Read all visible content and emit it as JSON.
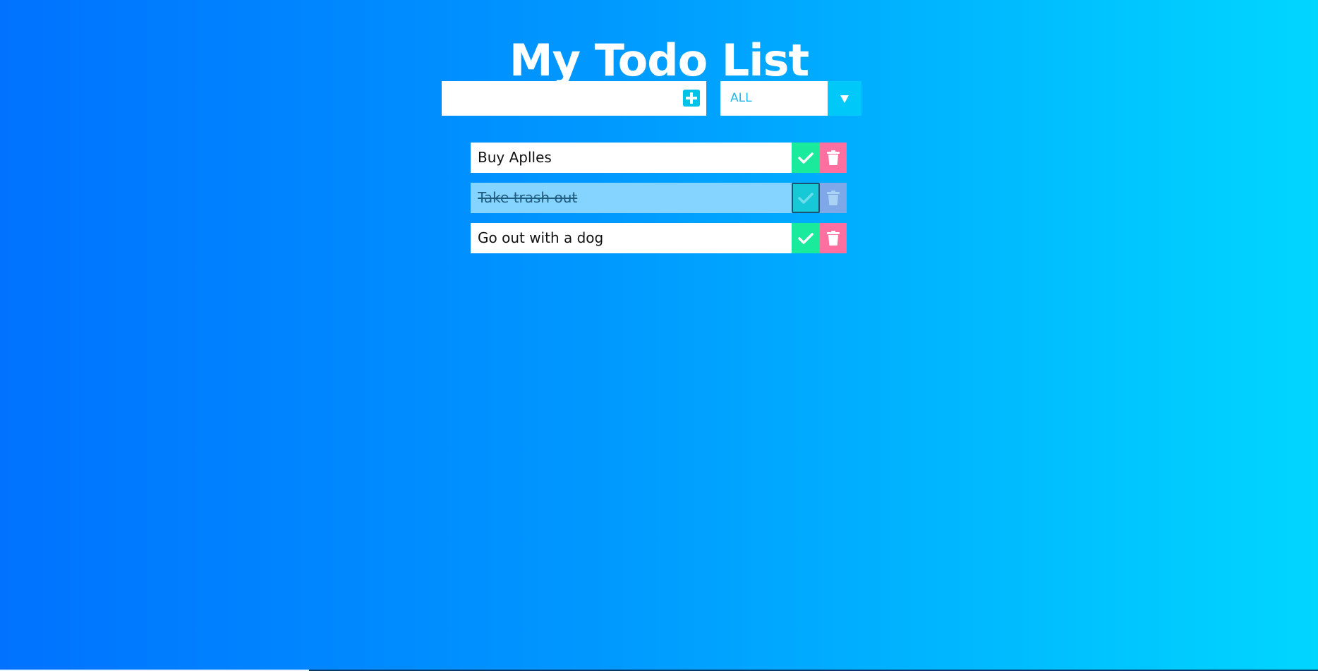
{
  "header": {
    "title": "My Todo List"
  },
  "add_form": {
    "input_value": "",
    "input_placeholder": "",
    "add_icon": "plus-square-icon"
  },
  "filter": {
    "selected": "ALL",
    "arrow_icon": "triangle-down-icon"
  },
  "todos": [
    {
      "text": "Buy Aplles",
      "completed": false
    },
    {
      "text": "Take trash out",
      "completed": true
    },
    {
      "text": "Go out with a dog",
      "completed": false
    }
  ],
  "icons": {
    "complete": "check-icon",
    "delete": "trash-icon"
  },
  "colors": {
    "background_start": "#0072ff",
    "background_end": "#00d6ff",
    "complete_button": "#19ea9c",
    "delete_button": "#ff6fa0",
    "accent": "#00c8f8",
    "completed_item": "#85d3ff"
  }
}
